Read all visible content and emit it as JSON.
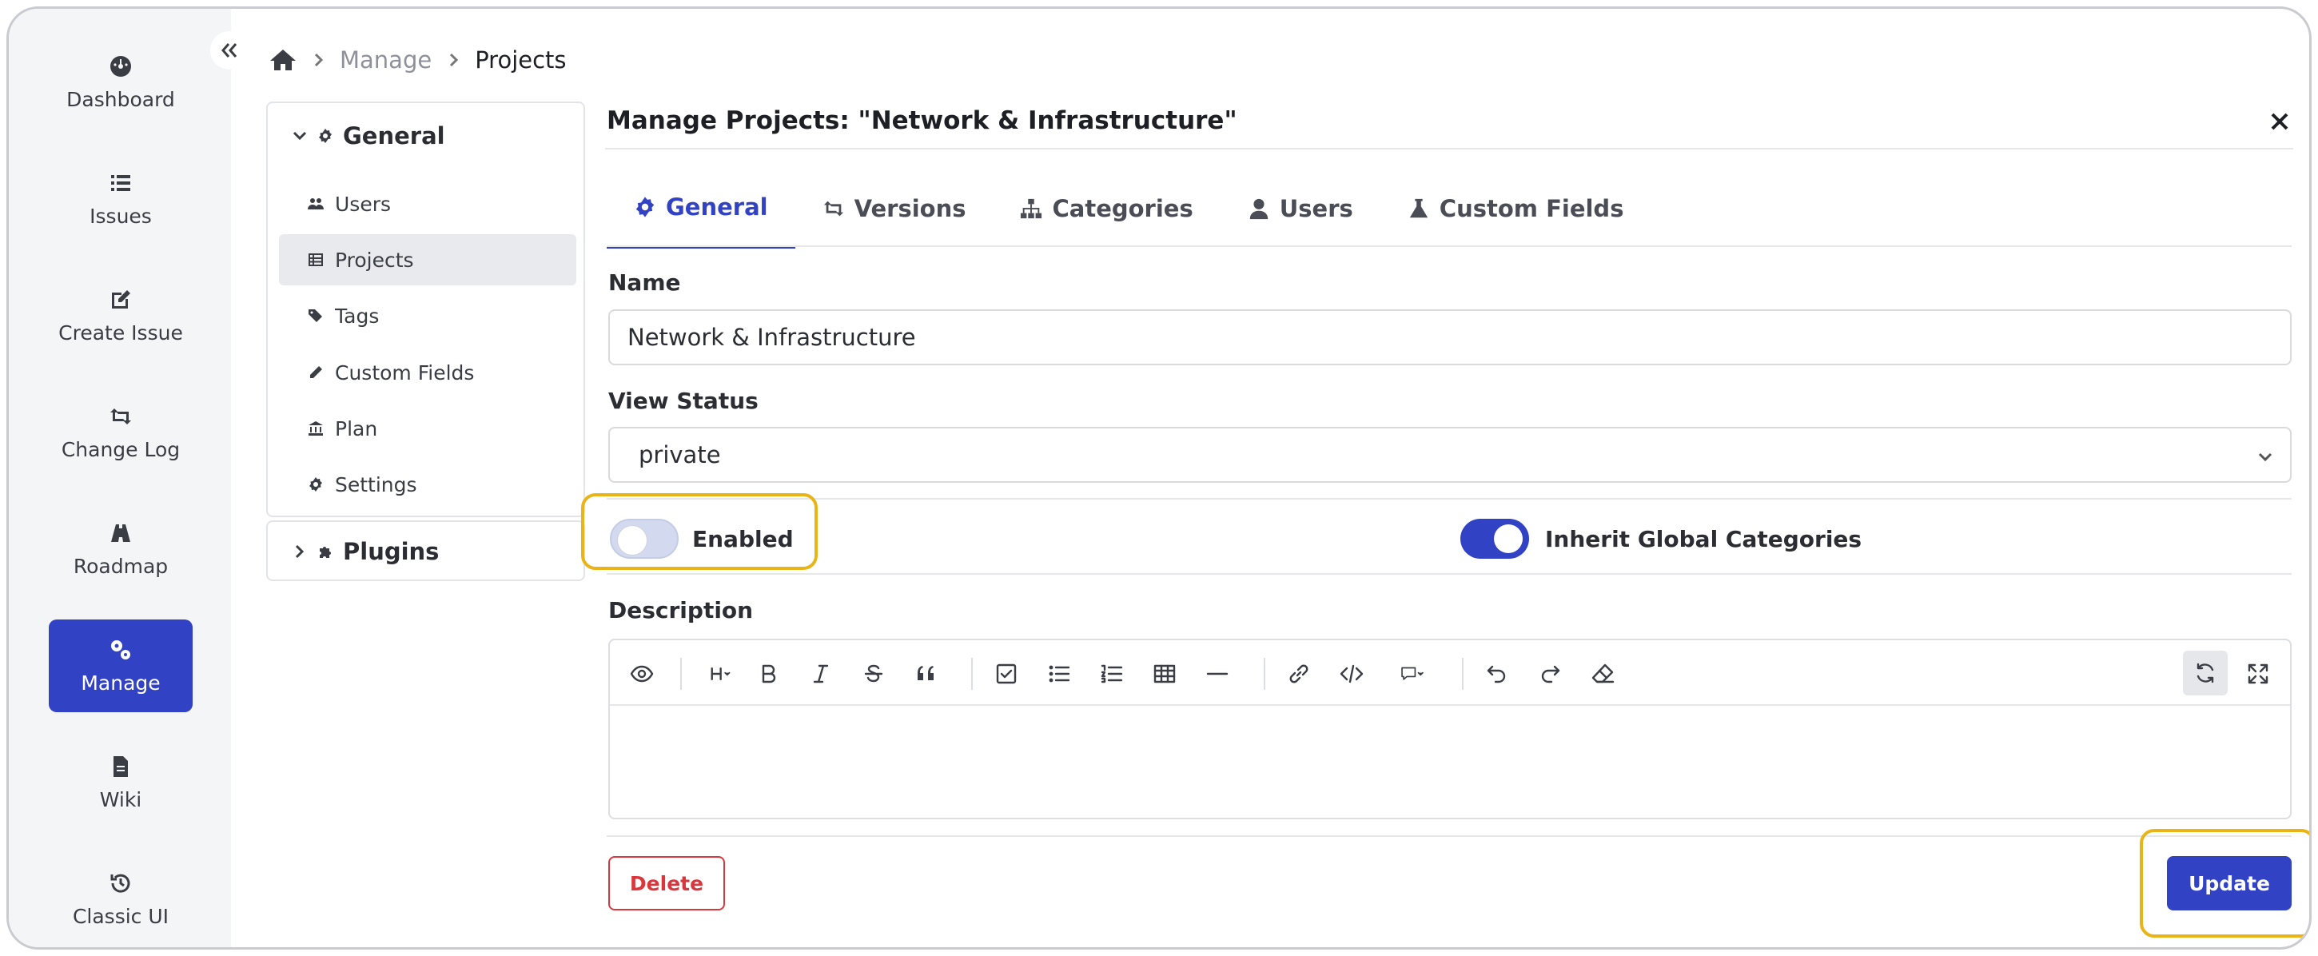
{
  "rail": {
    "items": [
      {
        "label": "Dashboard",
        "icon": "dashboard-icon"
      },
      {
        "label": "Issues",
        "icon": "list-icon"
      },
      {
        "label": "Create Issue",
        "icon": "edit-icon"
      },
      {
        "label": "Change Log",
        "icon": "retweet-icon"
      },
      {
        "label": "Roadmap",
        "icon": "road-icon"
      },
      {
        "label": "Manage",
        "icon": "gears-icon",
        "active": true
      },
      {
        "label": "Wiki",
        "icon": "file-icon"
      },
      {
        "label": "Classic UI",
        "icon": "history-icon"
      }
    ]
  },
  "breadcrumb": {
    "manage": "Manage",
    "current": "Projects"
  },
  "sidenav": {
    "general_label": "General",
    "items": [
      {
        "label": "Users",
        "icon": "users-icon"
      },
      {
        "label": "Projects",
        "icon": "table-icon",
        "active": true
      },
      {
        "label": "Tags",
        "icon": "tags-icon"
      },
      {
        "label": "Custom Fields",
        "icon": "pencil-icon"
      },
      {
        "label": "Plan",
        "icon": "bank-icon"
      },
      {
        "label": "Settings",
        "icon": "gear-icon"
      }
    ],
    "plugins_label": "Plugins"
  },
  "panel": {
    "title": "Manage Projects: \"Network & Infrastructure\"",
    "tabs": [
      {
        "label": "General",
        "icon": "gear-icon",
        "active": true
      },
      {
        "label": "Versions",
        "icon": "retweet-icon"
      },
      {
        "label": "Categories",
        "icon": "sitemap-icon"
      },
      {
        "label": "Users",
        "icon": "user-icon"
      },
      {
        "label": "Custom Fields",
        "icon": "flask-icon"
      }
    ],
    "name_label": "Name",
    "name_value": "Network & Infrastructure",
    "view_status_label": "View Status",
    "view_status_value": "private",
    "enabled_label": "Enabled",
    "enabled_on": false,
    "inherit_label": "Inherit Global Categories",
    "inherit_on": true,
    "description_label": "Description",
    "delete_label": "Delete",
    "update_label": "Update"
  },
  "colors": {
    "accent": "#3242c4",
    "danger": "#d9373d",
    "highlight": "#e9b417"
  }
}
